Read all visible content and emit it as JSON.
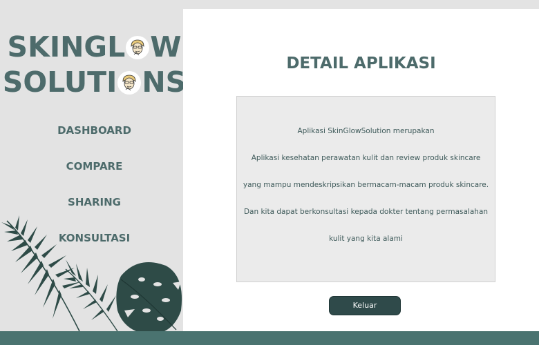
{
  "brand": {
    "line1_prefix": "SKINGL",
    "line1_suffix": "W",
    "line2_prefix": "SOLUTI",
    "line2_suffix": "NS"
  },
  "nav": {
    "items": [
      {
        "label": "DASHBOARD"
      },
      {
        "label": "COMPARE"
      },
      {
        "label": "SHARING"
      },
      {
        "label": "KONSULTASI"
      }
    ]
  },
  "main": {
    "title": "DETAIL APLIKASI",
    "description_lines": [
      "Aplikasi SkinGlowSolution merupakan",
      "Aplikasi kesehatan perawatan kulit dan review produk skincare",
      "yang mampu mendeskripsikan bermacam-macam produk skincare.",
      "Dan kita dapat berkonsultasi kepada dokter tentang permasalahan",
      "kulit yang kita alami"
    ],
    "exit_button": "Keluar"
  },
  "colors": {
    "accent": "#4d6b6b",
    "button": "#2f4a4a",
    "footer": "#4a7370",
    "sidebar_bg": "#e3e3e3",
    "leaf_dark": "#2e4b47"
  },
  "icons": [
    "skincare-face-icon",
    "monstera-leaves-decoration"
  ]
}
